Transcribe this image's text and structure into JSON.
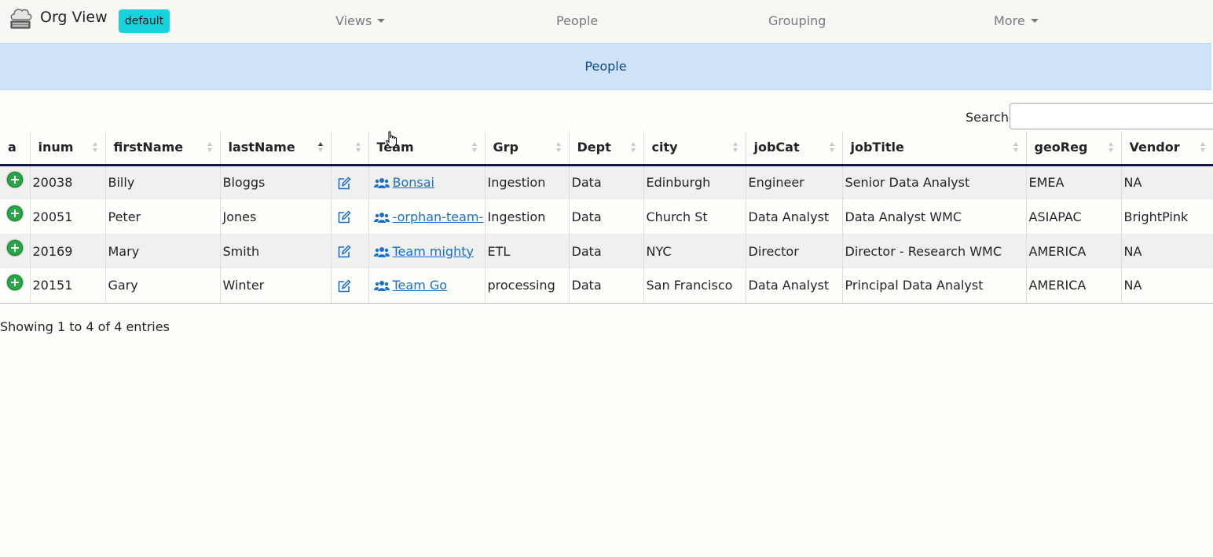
{
  "navbar": {
    "brand": "Org View",
    "badge": "default",
    "links": [
      "Views",
      "People",
      "Grouping",
      "More"
    ]
  },
  "banner": {
    "title": "People"
  },
  "search": {
    "label": "Search:",
    "value": ""
  },
  "table": {
    "columns": [
      "a",
      "inum",
      "firstName",
      "lastName",
      "",
      "Team",
      "Grp",
      "Dept",
      "city",
      "jobCat",
      "jobTitle",
      "geoReg",
      "Vendor"
    ],
    "sorted_column": "lastName",
    "sort_direction": "asc",
    "rows": [
      {
        "inum": "20038",
        "firstName": "Billy",
        "lastName": "Bloggs",
        "team": "Bonsai",
        "grp": "Ingestion",
        "dept": "Data",
        "city": "Edinburgh",
        "jobCat": "Engineer",
        "jobTitle": "Senior Data Analyst",
        "geoReg": "EMEA",
        "vendor": "NA"
      },
      {
        "inum": "20051",
        "firstName": "Peter",
        "lastName": "Jones",
        "team": "-orphan-team-",
        "grp": "Ingestion",
        "dept": "Data",
        "city": "Church St",
        "jobCat": "Data Analyst",
        "jobTitle": "Data Analyst WMC",
        "geoReg": "ASIAPAC",
        "vendor": "BrightPink"
      },
      {
        "inum": "20169",
        "firstName": "Mary",
        "lastName": "Smith",
        "team": "Team mighty",
        "grp": "ETL",
        "dept": "Data",
        "city": "NYC",
        "jobCat": "Director",
        "jobTitle": "Director - Research WMC",
        "geoReg": "AMERICA",
        "vendor": "NA"
      },
      {
        "inum": "20151",
        "firstName": "Gary",
        "lastName": "Winter",
        "team": "Team Go",
        "grp": "processing",
        "dept": "Data",
        "city": "San Francisco",
        "jobCat": "Data Analyst",
        "jobTitle": "Principal Data Analyst",
        "geoReg": "AMERICA",
        "vendor": "NA"
      }
    ]
  },
  "footer": {
    "info": "Showing 1 to 4 of 4 entries"
  },
  "colors": {
    "accent_badge": "#17d3df",
    "banner_bg": "#cfe2f7",
    "link": "#1a6fcc",
    "add_button": "#27a745",
    "header_rule": "#10154d"
  }
}
